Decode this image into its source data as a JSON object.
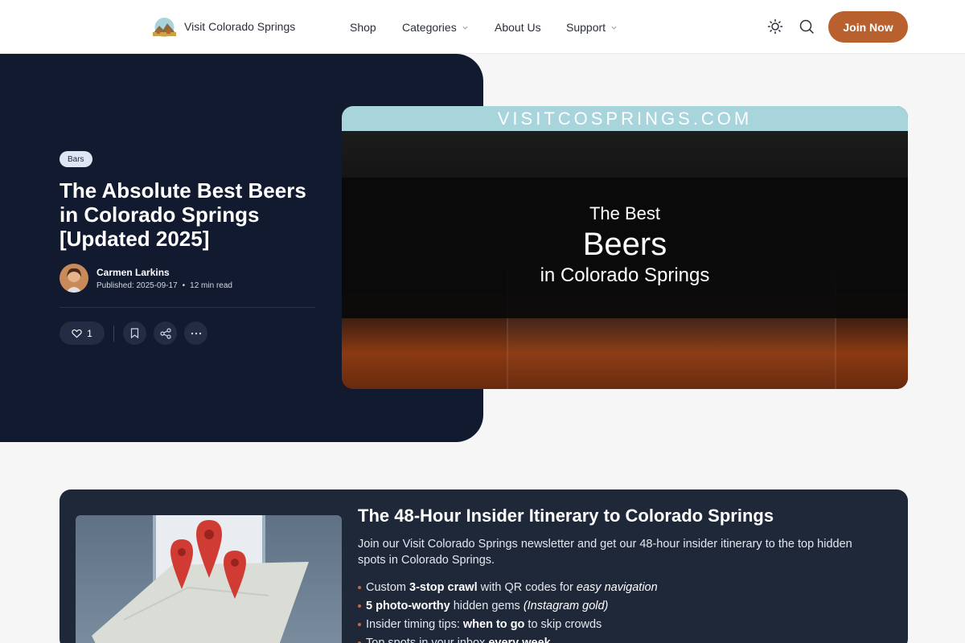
{
  "header": {
    "brand_name": "Visit Colorado Springs",
    "nav": [
      {
        "label": "Shop",
        "has_dropdown": false
      },
      {
        "label": "Categories",
        "has_dropdown": true
      },
      {
        "label": "About Us",
        "has_dropdown": false
      },
      {
        "label": "Support",
        "has_dropdown": true
      }
    ],
    "icons": [
      "sun-icon",
      "search-icon"
    ],
    "cta_label": "Join Now",
    "accent_color": "#b8612f"
  },
  "hero": {
    "tag": "Bars",
    "title": "The Absolute Best Beers in Colorado Springs [Updated 2025]",
    "author": {
      "name": "Carmen Larkins",
      "published": "Published: 2025-09-17",
      "read_time": "12 min read"
    },
    "actions": {
      "like_count": "1",
      "icons": [
        "heart-icon",
        "bookmark-icon",
        "share-icon",
        "more-icon"
      ]
    },
    "image": {
      "banner": "VISITCOSPRINGS.COM",
      "line1": "The Best",
      "line2": "Beers",
      "line3": "in Colorado Springs"
    },
    "panel_color": "#121a30"
  },
  "newsletter": {
    "title": "The 48-Hour Insider Itinerary to Colorado Springs",
    "description": "Join our Visit Colorado Springs newsletter and get our 48-hour insider itinerary to the top hidden spots in Colorado Springs.",
    "items": [
      {
        "pre": "Custom ",
        "bold": "3-stop crawl",
        "mid": " with QR codes for ",
        "italic": "easy navigation",
        "post": ""
      },
      {
        "pre": "",
        "bold": "5 photo-worthy",
        "mid": " hidden gems ",
        "italic": "(Instagram gold)",
        "post": ""
      },
      {
        "pre": "Insider timing tips: ",
        "bold": "when to go",
        "mid": " to skip crowds",
        "italic": "",
        "post": ""
      },
      {
        "pre": "Top spots in your inbox ",
        "bold": "every week",
        "mid": "",
        "italic": "",
        "post": ""
      }
    ],
    "background_color": "#1e2839"
  }
}
